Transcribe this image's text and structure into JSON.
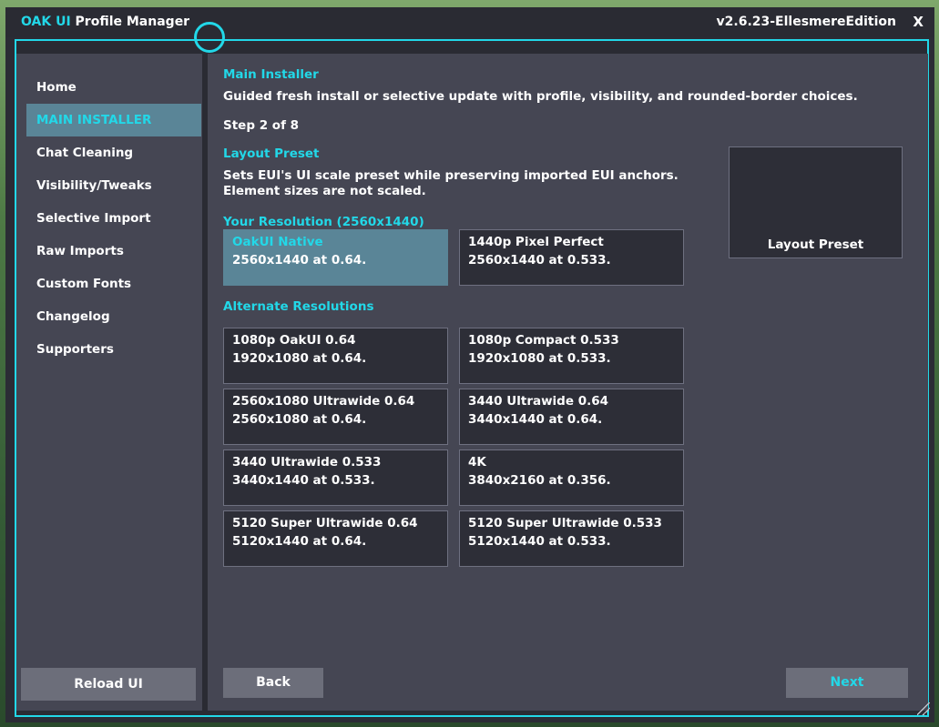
{
  "window": {
    "title_accent": "OAK UI",
    "title_rest": " Profile Manager",
    "version": "v2.6.23-EllesmereEdition",
    "close_label": "X"
  },
  "sidebar": {
    "items": [
      {
        "label": "Home",
        "active": false
      },
      {
        "label": "MAIN INSTALLER",
        "active": true
      },
      {
        "label": "Chat Cleaning",
        "active": false
      },
      {
        "label": "Visibility/Tweaks",
        "active": false
      },
      {
        "label": "Selective Import",
        "active": false
      },
      {
        "label": "Raw Imports",
        "active": false
      },
      {
        "label": "Custom Fonts",
        "active": false
      },
      {
        "label": "Changelog",
        "active": false
      },
      {
        "label": "Supporters",
        "active": false
      }
    ],
    "reload_label": "Reload UI"
  },
  "main": {
    "heading": "Main Installer",
    "subheading": "Guided fresh install or selective update with profile, visibility, and rounded-border choices.",
    "step": "Step 2 of 8",
    "section_title": "Layout Preset",
    "section_desc": "Sets EUI's UI scale preset while preserving imported EUI anchors. Element sizes are not scaled.",
    "preview_label": "Layout Preset",
    "your_resolution_label": "Your Resolution (2560x1440)",
    "your_options": [
      {
        "title": "OakUI Native",
        "subtitle": "2560x1440 at 0.64.",
        "selected": true
      },
      {
        "title": "1440p Pixel Perfect",
        "subtitle": "2560x1440 at 0.533.",
        "selected": false
      }
    ],
    "alternate_label": "Alternate Resolutions",
    "alternate_options": [
      {
        "title": "1080p OakUI 0.64",
        "subtitle": "1920x1080 at 0.64."
      },
      {
        "title": "1080p Compact 0.533",
        "subtitle": "1920x1080 at 0.533."
      },
      {
        "title": "2560x1080 Ultrawide 0.64",
        "subtitle": "2560x1080 at 0.64."
      },
      {
        "title": "3440 Ultrawide 0.64",
        "subtitle": "3440x1440 at 0.64."
      },
      {
        "title": "3440 Ultrawide 0.533",
        "subtitle": "3440x1440 at 0.533."
      },
      {
        "title": "4K",
        "subtitle": "3840x2160 at 0.356."
      },
      {
        "title": "5120 Super Ultrawide 0.64",
        "subtitle": "5120x1440 at 0.64."
      },
      {
        "title": "5120 Super Ultrawide 0.533",
        "subtitle": "5120x1440 at 0.533."
      }
    ],
    "back_label": "Back",
    "next_label": "Next"
  },
  "colors": {
    "accent": "#22d8e8",
    "selected": "#5a8597",
    "panel": "#454653",
    "button": "#6c6e7a"
  }
}
